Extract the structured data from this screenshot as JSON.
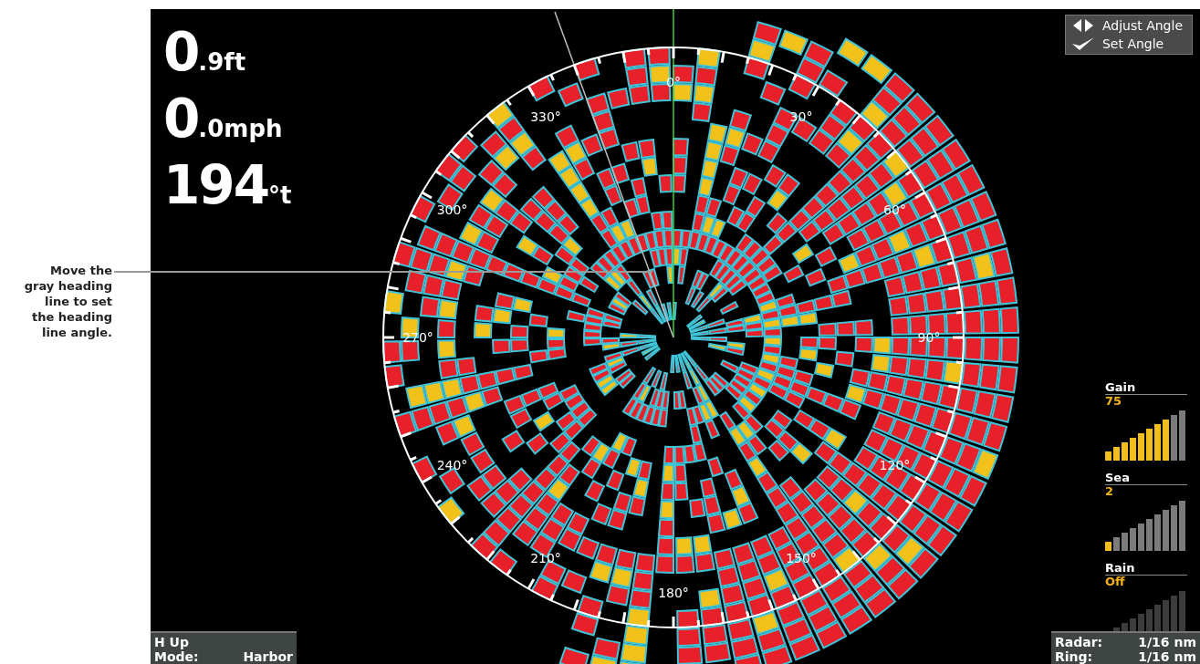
{
  "annotation": {
    "lines": [
      "Move the",
      "gray heading",
      "line to set",
      "the heading",
      "line angle."
    ]
  },
  "readouts": [
    {
      "value": "0",
      "unit": ".9ft"
    },
    {
      "value": "0",
      "unit": ".0mph"
    },
    {
      "value": "194",
      "unit": "°t"
    }
  ],
  "softkeys": [
    {
      "kind": "arrows",
      "label": "Adjust Angle"
    },
    {
      "kind": "check",
      "label": "Set Angle"
    }
  ],
  "ring_labels": [
    "0°",
    "30°",
    "60°",
    "90°",
    "120°",
    "150°",
    "180°",
    "210°",
    "240°",
    "270°",
    "300°",
    "330°"
  ],
  "meters": [
    {
      "name": "Gain",
      "reading": "75",
      "level": 0.8,
      "active": true
    },
    {
      "name": "Sea",
      "reading": "2",
      "level": 0.1,
      "active": true
    },
    {
      "name": "Rain",
      "reading": "Off",
      "level": 0,
      "active": false
    }
  ],
  "mode_box": {
    "orientation": "H Up",
    "label": "Mode:",
    "value": "Harbor"
  },
  "range_box": [
    {
      "label": "Radar:",
      "value": "1/16 nm"
    },
    {
      "label": "Ring:",
      "value": "1/16 nm"
    }
  ]
}
